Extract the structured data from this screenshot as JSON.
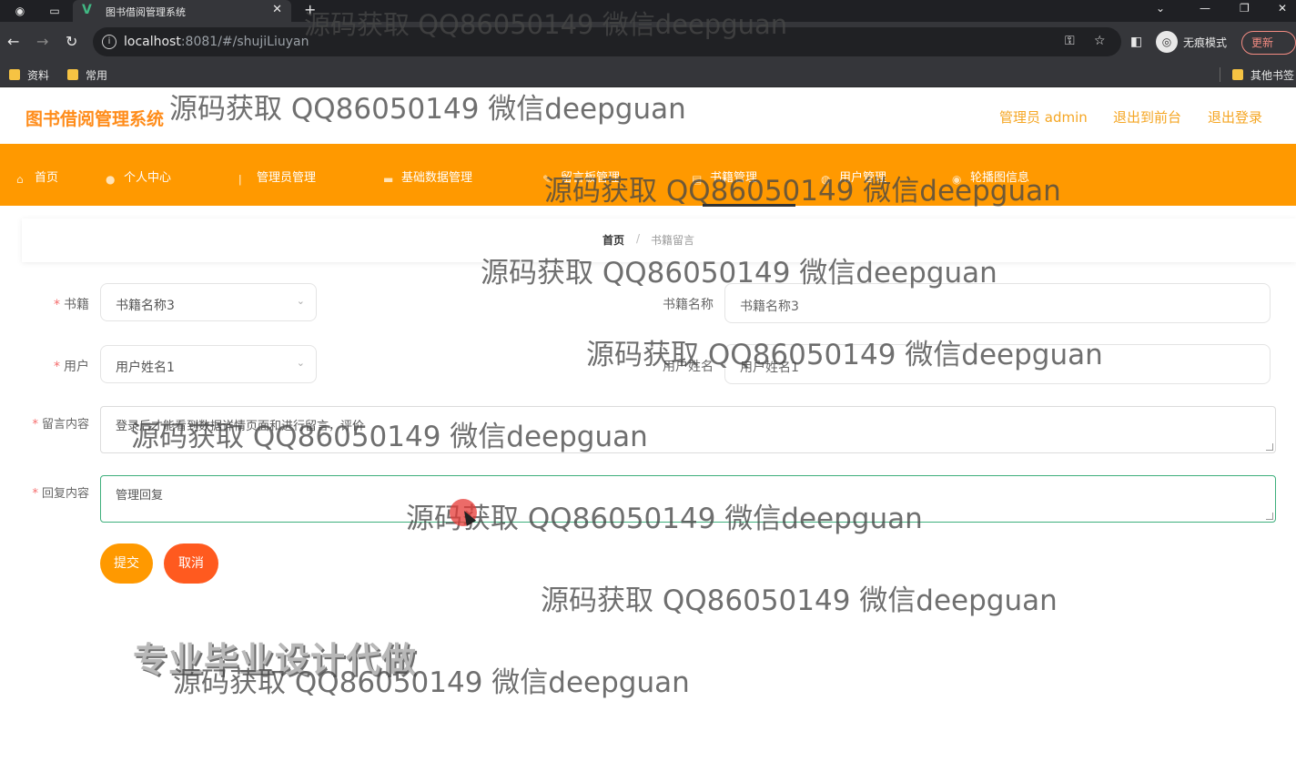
{
  "browser": {
    "tab_title": "图书借阅管理系统",
    "url_host": "localhost",
    "url_rest": ":8081/#/shujiLiuyan",
    "incognito_label": "无痕模式",
    "update_label": "更新",
    "bookmarks": [
      "资料",
      "常用"
    ],
    "other_bookmarks": "其他书签"
  },
  "header": {
    "logo": "图书借阅管理系统",
    "admin_label": "管理员 admin",
    "to_front_label": "退出到前台",
    "logout_label": "退出登录"
  },
  "nav": {
    "items": [
      {
        "label": "首页",
        "icon": "home-icon"
      },
      {
        "label": "个人中心",
        "icon": "user-icon"
      },
      {
        "label": "管理员管理",
        "icon": "admin-icon"
      },
      {
        "label": "基础数据管理",
        "icon": "folder-icon"
      },
      {
        "label": "留言板管理",
        "icon": "message-icon"
      },
      {
        "label": "书籍管理",
        "icon": "book-icon"
      },
      {
        "label": "用户管理",
        "icon": "users-icon"
      },
      {
        "label": "轮播图信息",
        "icon": "image-icon"
      }
    ],
    "active_index": 5
  },
  "breadcrumb": {
    "home": "首页",
    "separator": "/",
    "current": "书籍留言"
  },
  "form": {
    "book_label": "书籍",
    "book_value": "书籍名称3",
    "book_name_label": "书籍名称",
    "book_name_value": "书籍名称3",
    "user_label": "用户",
    "user_value": "用户姓名1",
    "user_name_label": "用户姓名",
    "user_name_value": "用户姓名1",
    "message_label": "留言内容",
    "message_value": "登录后才能看到数据详情页面和进行留言，评价",
    "reply_label": "回复内容",
    "reply_value": "管理回复",
    "submit_label": "提交",
    "cancel_label": "取消"
  },
  "overlay": {
    "watermark": "源码获取 QQ86050149 微信deepguan",
    "promo": "专业毕业设计代做"
  },
  "colors": {
    "nav_bg": "#ff9900",
    "accent": "#f5a623",
    "submit_bg": "#ff9900",
    "cancel_bg": "#ff5a1f"
  }
}
